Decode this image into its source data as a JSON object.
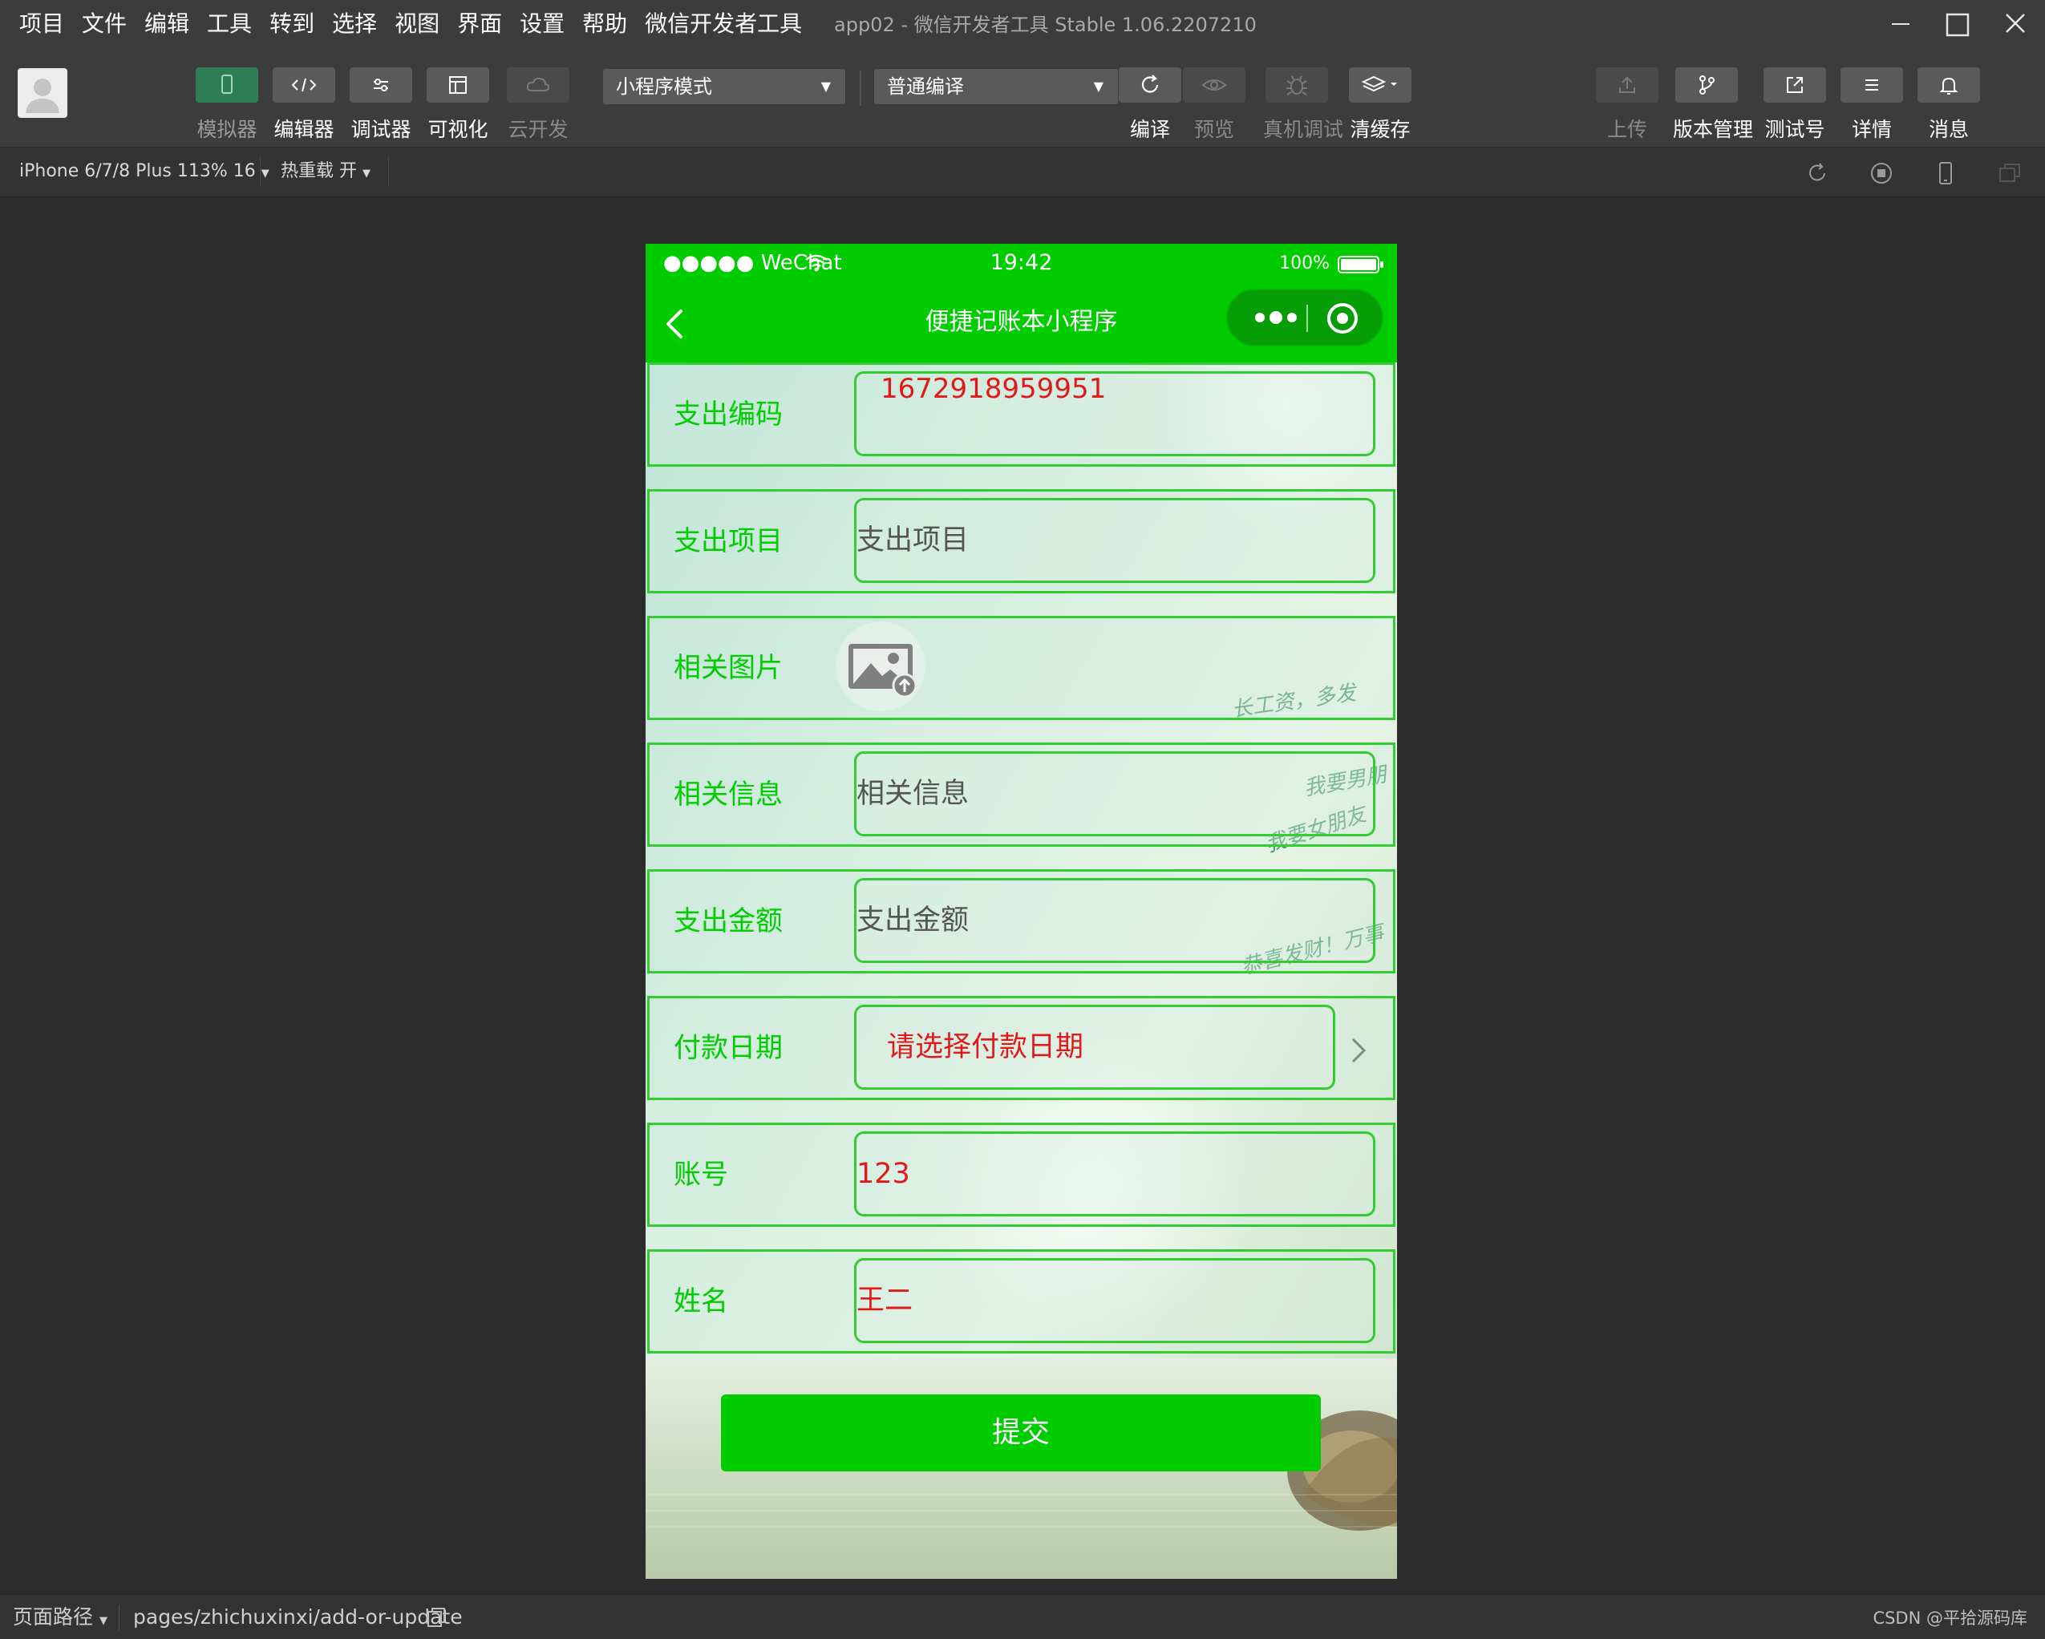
{
  "menubar": {
    "items": [
      "项目",
      "文件",
      "编辑",
      "工具",
      "转到",
      "选择",
      "视图",
      "界面",
      "设置",
      "帮助",
      "微信开发者工具"
    ],
    "window_title": "app02 - 微信开发者工具 Stable 1.06.2207210"
  },
  "toolbar": {
    "left_buttons": [
      {
        "label": "模拟器",
        "icon": "phone-icon"
      },
      {
        "label": "编辑器",
        "icon": "code-icon"
      },
      {
        "label": "调试器",
        "icon": "sliders-icon"
      },
      {
        "label": "可视化",
        "icon": "layout-icon"
      },
      {
        "label": "云开发",
        "icon": "cloud-icon"
      }
    ],
    "mode_select": "小程序模式",
    "compile_select": "普通编译",
    "mid_buttons": [
      {
        "label": "编译",
        "icon": "refresh-icon"
      },
      {
        "label": "预览",
        "icon": "eye-icon"
      },
      {
        "label": "真机调试",
        "icon": "bug-icon"
      },
      {
        "label": "清缓存",
        "icon": "layers-icon"
      }
    ],
    "right_buttons": [
      {
        "label": "上传",
        "icon": "upload-icon"
      },
      {
        "label": "版本管理",
        "icon": "branch-icon"
      },
      {
        "label": "测试号",
        "icon": "external-link-icon"
      },
      {
        "label": "详情",
        "icon": "menu-icon"
      },
      {
        "label": "消息",
        "icon": "bell-icon"
      }
    ]
  },
  "devicebar": {
    "device": "iPhone 6/7/8 Plus 113% 16",
    "hot_reload": "热重载 开"
  },
  "phone": {
    "status": {
      "carrier": "●●●●● WeChat",
      "time": "19:42",
      "battery": "100%"
    },
    "nav_title": "便捷记账本小程序",
    "form": {
      "code_label": "支出编码",
      "code_value": "1672918959951",
      "item_label": "支出项目",
      "item_placeholder": "支出项目",
      "image_label": "相关图片",
      "info_label": "相关信息",
      "info_placeholder": "相关信息",
      "amount_label": "支出金额",
      "amount_placeholder": "支出金额",
      "date_label": "付款日期",
      "date_value": "请选择付款日期",
      "account_label": "账号",
      "account_value": "123",
      "name_label": "姓名",
      "name_value": "王二"
    },
    "bg_texts": [
      "长工资，多发",
      "我要男朋",
      "我要女朋友",
      "恭喜发财！万事"
    ],
    "submit_label": "提交"
  },
  "bottombar": {
    "path_label": "页面路径",
    "path": "pages/zhichuxinxi/add-or-update",
    "watermark": "CSDN @平拾源码库"
  },
  "colors": {
    "accent_green": "#00cc00",
    "border_green": "#33cc33",
    "value_red": "#e01a1a",
    "ide_dark": "#3c3c3c"
  }
}
